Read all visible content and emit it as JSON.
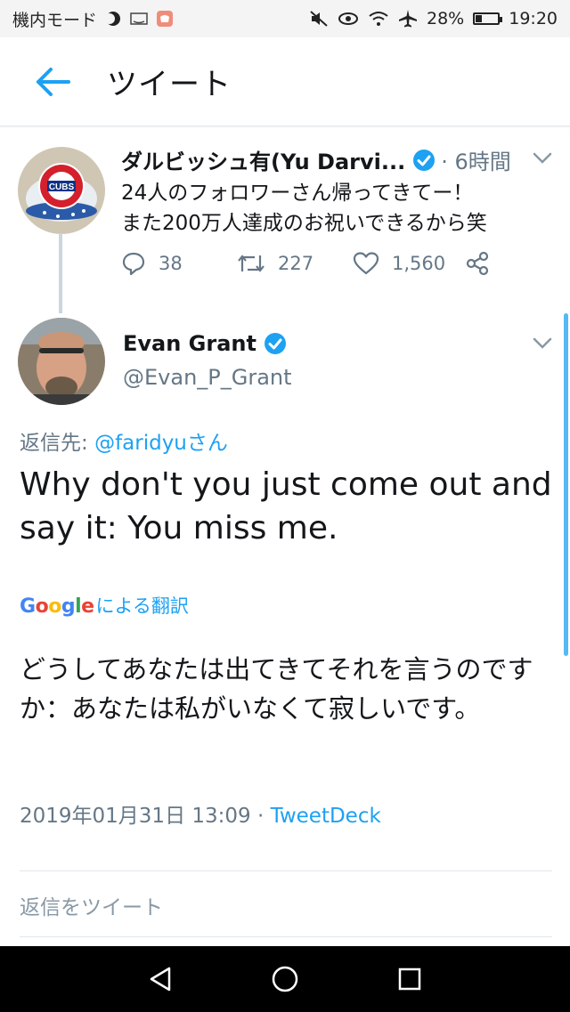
{
  "status_bar": {
    "mode": "機内モード",
    "battery": "28%",
    "battery_level": 0.28,
    "time": "19:20"
  },
  "header": {
    "title": "ツイート"
  },
  "parent_tweet": {
    "name": "ダルビッシュ有(Yu Darvi...",
    "time": "· 6時間",
    "text_line1": "24人のフォロワーさん帰ってきてー！",
    "text_line2": "また200万人達成のお祝いできるから笑",
    "replies": "38",
    "retweets": "227",
    "likes": "1,560",
    "avatar_text": "CUBS"
  },
  "main_tweet": {
    "name": "Evan Grant",
    "handle": "@Evan_P_Grant",
    "reply_prefix": "返信先: ",
    "reply_mention": "@faridyuさん",
    "text": "Why don't you just come out and say it: You miss me.",
    "translate_label": "による翻訳",
    "translated": "どうしてあなたは出てきてそれを言うのですか：あなたは私がいなくて寂しいです。",
    "timestamp": "2019年01月31日 13:09 · ",
    "source": "TweetDeck"
  },
  "reply_placeholder": "返信をツイート",
  "colors": {
    "accent": "#1da1f2",
    "muted": "#657786"
  }
}
